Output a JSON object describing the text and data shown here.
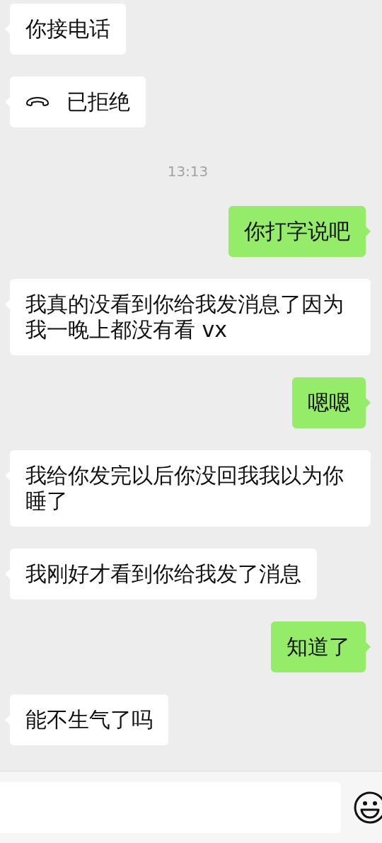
{
  "messages": [
    {
      "kind": "text",
      "outgoing": false,
      "text": "你接电话"
    },
    {
      "kind": "call",
      "outgoing": false,
      "text": "已拒绝"
    },
    {
      "kind": "time",
      "text": "13:13"
    },
    {
      "kind": "text",
      "outgoing": true,
      "text": "你打字说吧"
    },
    {
      "kind": "text",
      "outgoing": false,
      "text": "我真的没看到你给我发消息了因为我一晚上都没有看 vx"
    },
    {
      "kind": "text",
      "outgoing": true,
      "text": "嗯嗯"
    },
    {
      "kind": "text",
      "outgoing": false,
      "text": "我给你发完以后你没回我我以为你睡了"
    },
    {
      "kind": "text",
      "outgoing": false,
      "text": "我刚好才看到你给我发了消息"
    },
    {
      "kind": "text",
      "outgoing": true,
      "text": "知道了"
    },
    {
      "kind": "text",
      "outgoing": false,
      "text": "能不生气了吗"
    }
  ]
}
